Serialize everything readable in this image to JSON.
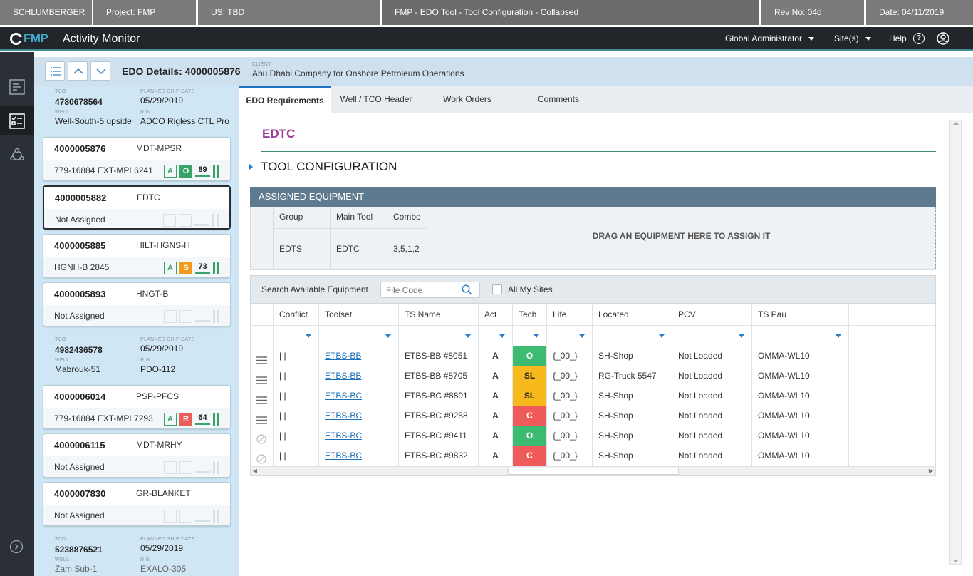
{
  "info_bar": {
    "company": "SCHLUMBERGER",
    "project": "Project:  FMP",
    "us": "US:  TBD",
    "screen": "FMP - EDO Tool - Tool Configuration - Collapsed",
    "rev": "Rev No:  04d",
    "date": "Date:  04/11/2019"
  },
  "app": {
    "logo_text": "FMP",
    "title": "Activity Monitor",
    "role": "Global Administrator",
    "sites": "Site(s)",
    "help": "Help",
    "help_icon_glyph": "?"
  },
  "detail_header": {
    "title": "EDO Details: 4000005876",
    "client_label": "CLIENT",
    "client_value": "Abu Dhabi Company for Onshore Petroleum Operations"
  },
  "list": {
    "labels": {
      "tco": "TCO",
      "planned_ship_date": "PLANNED SHIP DATE",
      "well": "WELL",
      "rig": "RIG"
    },
    "groups": [
      {
        "tco": "4780678564",
        "planned_ship_date": "05/29/2019",
        "well": "Well-South-5 upside",
        "rig": "ADCO Rigless CTL Pro"
      },
      {
        "tco": "4982436578",
        "planned_ship_date": "05/29/2019",
        "well": "Mabrouk-51",
        "rig": "PDO-112"
      },
      {
        "tco": "5238876521",
        "planned_ship_date": "05/29/2019",
        "well": "Zam Sub-1",
        "rig": "EXALO-305"
      }
    ],
    "cards": [
      {
        "id": "4000005876",
        "code": "MDT-MPSR",
        "sub": "779-16884 EXT-MPL6241",
        "badge1": "A",
        "badge2": "O",
        "score": "89"
      },
      {
        "id": "4000005882",
        "code": "EDTC",
        "sub": "Not Assigned"
      },
      {
        "id": "4000005885",
        "code": "HILT-HGNS-H",
        "sub": "HGNH-B 2845",
        "badge1": "A",
        "badge2": "S",
        "score": "73"
      },
      {
        "id": "4000005893",
        "code": "HNGT-B",
        "sub": "Not Assigned"
      },
      {
        "id": "4000006014",
        "code": "PSP-PFCS",
        "sub": "779-16884 EXT-MPL7293",
        "badge1": "A",
        "badge2": "R",
        "score": "64"
      },
      {
        "id": "4000006115",
        "code": "MDT-MRHY",
        "sub": "Not Assigned"
      },
      {
        "id": "4000007830",
        "code": "GR-BLANKET",
        "sub": "Not Assigned"
      }
    ]
  },
  "tabs": [
    "EDO Requirements",
    "Well / TCO Header",
    "Work Orders",
    "Comments"
  ],
  "section": {
    "title": "EDTC",
    "subsection": "TOOL CONFIGURATION"
  },
  "assigned": {
    "header": "ASSIGNED EQUIPMENT",
    "cols": [
      "Group",
      "Main Tool",
      "Combo"
    ],
    "values": [
      "EDTS",
      "EDTC",
      "3,5,1,2"
    ],
    "drop_hint": "DRAG AN EQUIPMENT HERE TO ASSIGN IT"
  },
  "search": {
    "label": "Search Available Equipment",
    "placeholder": "File Code",
    "checkbox_label": "All My Sites"
  },
  "grid": {
    "columns": [
      "Conflict",
      "Toolset",
      "TS Name",
      "Act",
      "Tech",
      "Life",
      "Located",
      "PCV",
      "TS Pau"
    ],
    "rows": [
      {
        "icon": "drag",
        "conflict": "| |",
        "toolset": "ETBS-BB",
        "ts_name": "ETBS-BB #8051",
        "act": "A",
        "tech": "O",
        "life": "{_00_}",
        "located": "SH-Shop",
        "pcv": "Not Loaded",
        "ts_pau": "OMMA-WL10"
      },
      {
        "icon": "drag",
        "conflict": "| |",
        "toolset": "ETBS-BB",
        "ts_name": "ETBS-BB #8705",
        "act": "A",
        "tech": "SL",
        "life": "{_00_}",
        "located": "RG-Truck 5547",
        "pcv": "Not Loaded",
        "ts_pau": "OMMA-WL10"
      },
      {
        "icon": "drag",
        "conflict": "| |",
        "toolset": "ETBS-BC",
        "ts_name": "ETBS-BC #8891",
        "act": "A",
        "tech": "SL",
        "life": "{_00_}",
        "located": "SH-Shop",
        "pcv": "Not Loaded",
        "ts_pau": "OMMA-WL10"
      },
      {
        "icon": "drag",
        "conflict": "| |",
        "toolset": "ETBS-BC",
        "ts_name": "ETBS-BC #9258",
        "act": "A",
        "tech": "C",
        "life": "{_00_}",
        "located": "SH-Shop",
        "pcv": "Not Loaded",
        "ts_pau": "OMMA-WL10"
      },
      {
        "icon": "blocked",
        "conflict": "| |",
        "toolset": "ETBS-BC",
        "ts_name": "ETBS-BC #9411",
        "act": "A",
        "tech": "O",
        "life": "{_00_}",
        "located": "SH-Shop",
        "pcv": "Not Loaded",
        "ts_pau": "OMMA-WL10"
      },
      {
        "icon": "blocked",
        "conflict": "| |",
        "toolset": "ETBS-BC",
        "ts_name": "ETBS-BC #9832",
        "act": "A",
        "tech": "C",
        "life": "{_00_}",
        "located": "SH-Shop",
        "pcv": "Not Loaded",
        "ts_pau": "OMMA-WL10"
      }
    ]
  },
  "colors": {
    "tech_o": "#3dbb72",
    "tech_sl": "#f7b91b",
    "tech_c": "#ef5a5a",
    "accent": "#1c74c2",
    "section_title": "#9b3d98"
  }
}
